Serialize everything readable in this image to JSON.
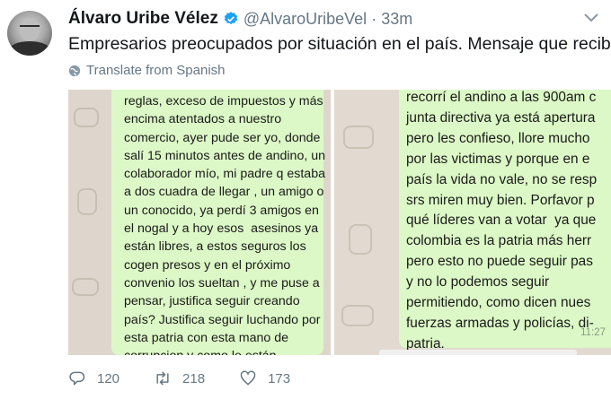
{
  "tweet": {
    "author_name": "Álvaro Uribe Vélez",
    "handle": "@AlvaroUribeVel",
    "separator": "·",
    "time": "33m",
    "text": "Empresarios preocupados por situación en el país. Mensaje que recibo.",
    "translate_label": "Translate from Spanish"
  },
  "media": {
    "left_message": "reglas, exceso de impuestos y más\nencima atentados a nuestro\ncomercio, ayer pude ser yo, donde\nsalí 15 minutos antes de andino, un\ncolaborador mío, mi padre q estaba\na dos cuadra de llegar , un amigo o\nun conocido, ya perdí 3 amigos en\nel nogal y a hoy esos  asesinos ya\nestán libres, a estos seguros los\ncogen presos y en el próximo\nconvenio los sueltan , y me puse a\npensar, justifica seguir creando\npaís? Justifica seguir luchando por\nesta patria con esta mano de\ncorrupcion y como le están\nentregando el\nPaís a los bandidos y a la",
    "right_message": "recorrí el andino a las 900am c\njunta directiva ya está apertura\npero les confieso, llore mucho\npor las victimas y porque en e\npaís la vida no vale, no se resp\nsrs miren muy bien. Porfavor p\nqué líderes van a votar  ya que\ncolombia es la patria más herr\npero esto no puede seguir pas\ny no lo podemos seguir\npermitiendo, como dicen nues\nfuerzas armadas y policías, di-\npatria.",
    "right_timestamp": "11:27"
  },
  "actions": {
    "replies": "120",
    "retweets": "218",
    "likes": "173"
  },
  "icons": {
    "verified": "verified-badge-icon",
    "chevron": "chevron-down-icon",
    "globe": "globe-icon",
    "reply": "reply-icon",
    "retweet": "retweet-icon",
    "like": "heart-icon"
  },
  "colors": {
    "verified_blue": "#1da1f2",
    "secondary_text": "#657786",
    "bubble_green": "#dcf8c6"
  }
}
